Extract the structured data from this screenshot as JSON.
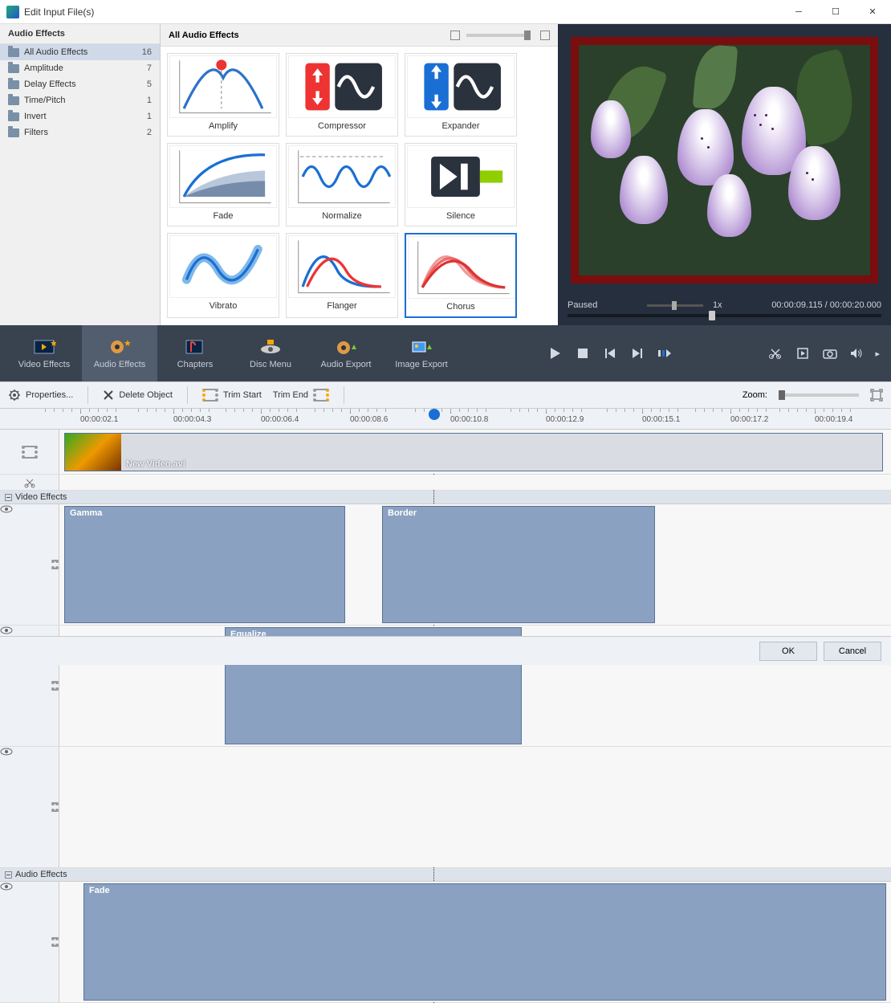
{
  "window": {
    "title": "Edit Input File(s)"
  },
  "sidebar": {
    "header": "Audio Effects",
    "items": [
      {
        "label": "All Audio Effects",
        "count": "16",
        "selected": true
      },
      {
        "label": "Amplitude",
        "count": "7"
      },
      {
        "label": "Delay Effects",
        "count": "5"
      },
      {
        "label": "Time/Pitch",
        "count": "1"
      },
      {
        "label": "Invert",
        "count": "1"
      },
      {
        "label": "Filters",
        "count": "2"
      }
    ]
  },
  "gallery": {
    "header": "All Audio Effects",
    "items": [
      {
        "label": "Amplify"
      },
      {
        "label": "Compressor"
      },
      {
        "label": "Expander"
      },
      {
        "label": "Fade"
      },
      {
        "label": "Normalize"
      },
      {
        "label": "Silence"
      },
      {
        "label": "Vibrato"
      },
      {
        "label": "Flanger"
      },
      {
        "label": "Chorus",
        "selected": true
      }
    ]
  },
  "preview": {
    "status": "Paused",
    "speed": "1x",
    "position": "00:00:09.115",
    "duration": "00:00:20.000"
  },
  "ribbon": {
    "tabs": [
      {
        "label": "Video Effects"
      },
      {
        "label": "Audio Effects",
        "selected": true
      },
      {
        "label": "Chapters"
      },
      {
        "label": "Disc Menu"
      },
      {
        "label": "Audio Export"
      },
      {
        "label": "Image Export"
      }
    ]
  },
  "toolbar": {
    "properties": "Properties...",
    "delete": "Delete Object",
    "trimStart": "Trim Start",
    "trimEnd": "Trim End",
    "zoom": "Zoom:"
  },
  "ruler": {
    "marks": [
      {
        "pos": 100,
        "label": "00:00:02.1"
      },
      {
        "pos": 216,
        "label": "00:00:04.3"
      },
      {
        "pos": 325,
        "label": "00:00:06.4"
      },
      {
        "pos": 436,
        "label": "00:00:08.6"
      },
      {
        "pos": 561,
        "label": "00:00:10.8"
      },
      {
        "pos": 680,
        "label": "00:00:12.9"
      },
      {
        "pos": 800,
        "label": "00:00:15.1"
      },
      {
        "pos": 910,
        "label": "00:00:17.2"
      },
      {
        "pos": 1015,
        "label": "00:00:19.4"
      }
    ]
  },
  "timeline": {
    "clipName": "New Video.avi",
    "groupVideo": "Video Effects",
    "groupAudio": "Audio Effects",
    "effects": {
      "gamma": "Gamma",
      "border": "Border",
      "equalize": "Equalize",
      "fade": "Fade"
    }
  },
  "footer": {
    "ok": "OK",
    "cancel": "Cancel"
  }
}
